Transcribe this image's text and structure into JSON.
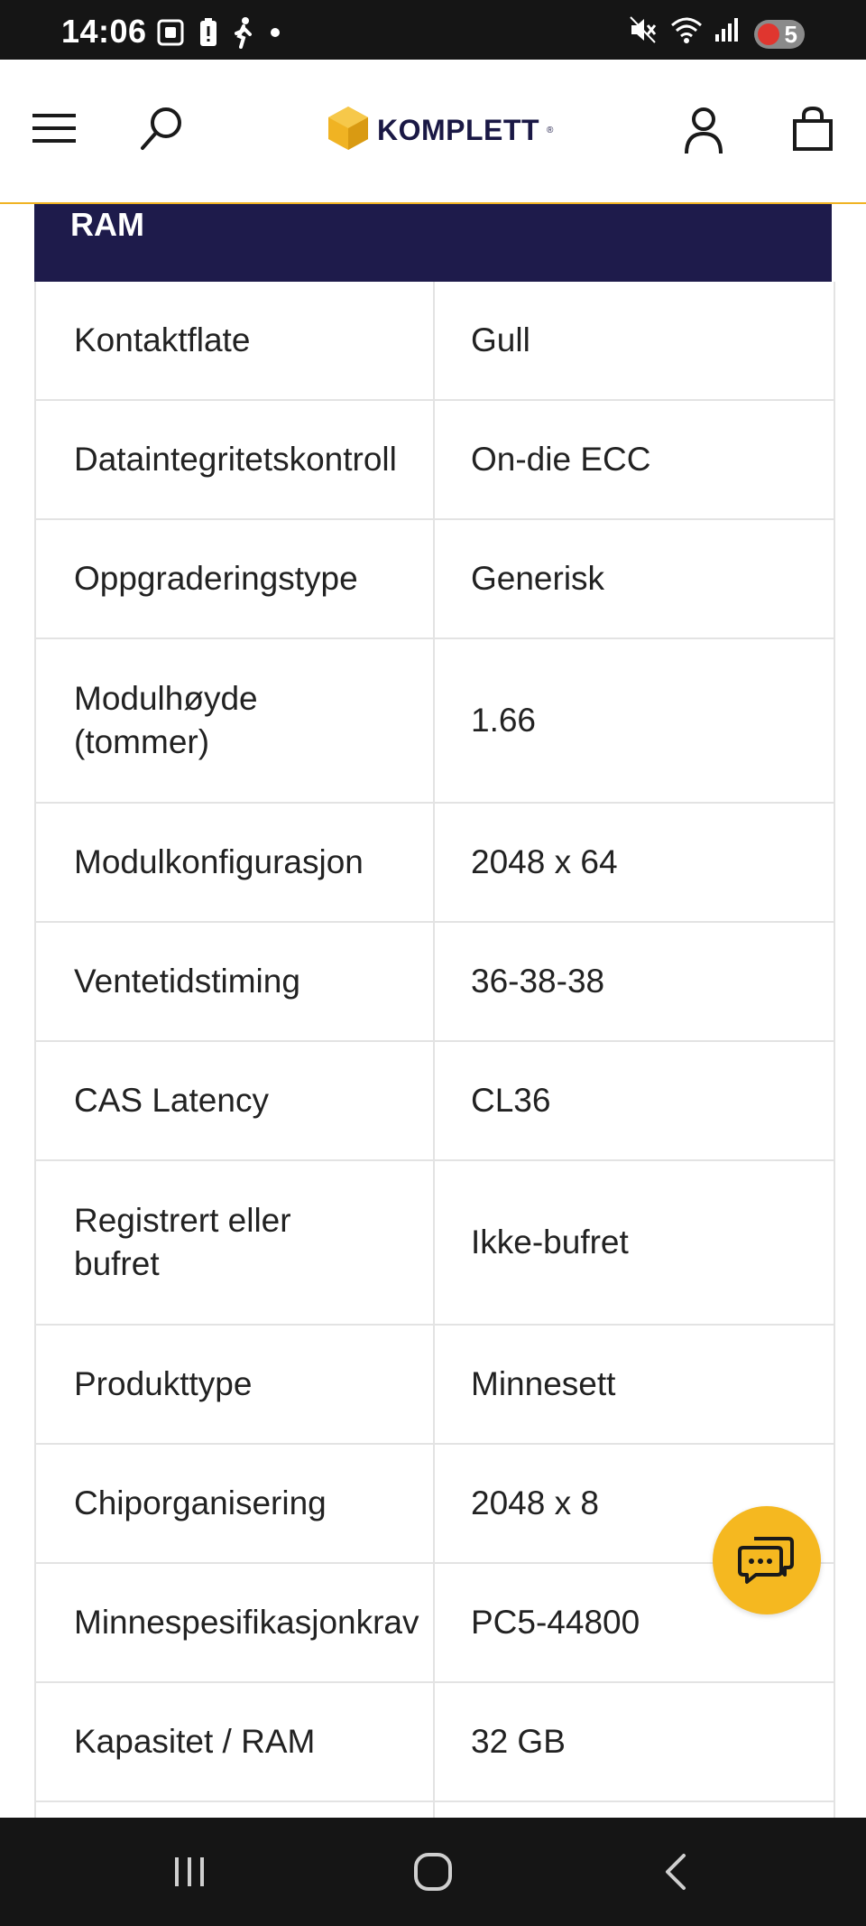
{
  "status_bar": {
    "time": "14:06",
    "battery_level": "5",
    "left_icons": [
      "screenshot-icon",
      "battery-alert-icon",
      "walking-icon",
      "dot-icon"
    ],
    "right_icons": [
      "mute-icon",
      "wifi-icon",
      "signal-icon"
    ]
  },
  "header": {
    "brand": "KOMPLETT",
    "brand_mark": "®",
    "brand_color": "#f0b323",
    "icons": [
      "menu-icon",
      "search-icon",
      "account-icon",
      "cart-icon"
    ]
  },
  "section": {
    "title": "RAM",
    "bar_color": "#1e1b4b"
  },
  "specs": [
    {
      "label": "Kontaktflate",
      "value": "Gull"
    },
    {
      "label": "Dataintegritetskontroll",
      "value": "On-die ECC"
    },
    {
      "label": "Oppgraderingstype",
      "value": "Generisk"
    },
    {
      "label": "Modulhøyde (tommer)",
      "value": "1.66"
    },
    {
      "label": "Modulkonfigurasjon",
      "value": "2048 x 64"
    },
    {
      "label": "Ventetidstiming",
      "value": "36-38-38"
    },
    {
      "label": "CAS Latency",
      "value": "CL36"
    },
    {
      "label": "Registrert eller bufret",
      "value": "Ikke-bufret"
    },
    {
      "label": "Produkttype",
      "value": "Minnesett"
    },
    {
      "label": "Chiporganisering",
      "value": "2048 x 8"
    },
    {
      "label": "Minnespesifikasjonkrav",
      "value": "PC5-44800"
    },
    {
      "label": "Kapasitet / RAM",
      "value": "32 GB"
    },
    {
      "label": "",
      "value": ""
    }
  ],
  "chat": {
    "icon": "chat-icon",
    "color": "#f5b820"
  },
  "nav": {
    "icons": [
      "recent-apps-icon",
      "home-icon",
      "back-icon"
    ]
  }
}
